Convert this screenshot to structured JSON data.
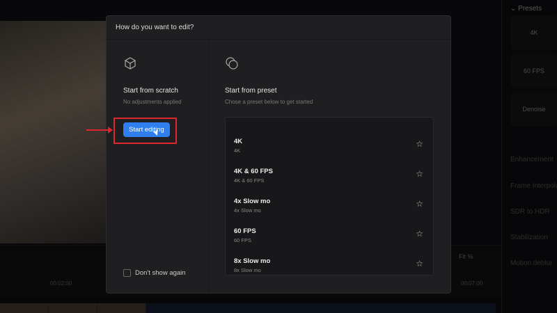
{
  "modal": {
    "title": "How do you want to edit?",
    "scratch": {
      "title": "Start from scratch",
      "subtitle": "No adjustments applied",
      "button": "Start editing",
      "dont_show": "Don't show again"
    },
    "preset": {
      "title": "Start from preset",
      "subtitle": "Chose a preset below to get started",
      "items": [
        {
          "name": "4K",
          "desc": "4K"
        },
        {
          "name": "4K & 60 FPS",
          "desc": "4K & 60 FPS"
        },
        {
          "name": "4x Slow mo",
          "desc": "4x Slow mo"
        },
        {
          "name": "60 FPS",
          "desc": "60 FPS"
        },
        {
          "name": "8x Slow mo",
          "desc": "8x Slow mo"
        }
      ]
    }
  },
  "timeline": {
    "t1": "00:02:00",
    "t2": "00:07:00",
    "fit": "Fit %"
  },
  "sidebar": {
    "header": "Presets",
    "cards": [
      "4K",
      "60 FPS",
      "Denoise"
    ],
    "items": [
      "Enhancement",
      "Frame Interpola",
      "SDR to HDR",
      "Stabilization",
      "Motion deblur"
    ]
  },
  "accent": "#2f7ff0",
  "highlight": "#e0262a"
}
